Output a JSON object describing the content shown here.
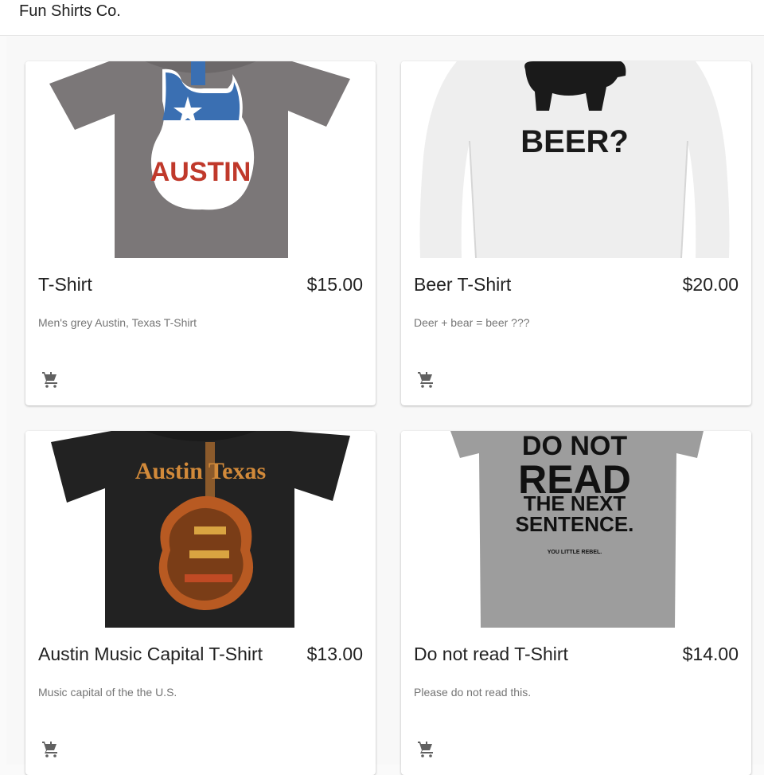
{
  "app": {
    "title": "Fun Shirts Co."
  },
  "products": [
    {
      "name": "T-Shirt",
      "price": "$15.00",
      "description": "Men's grey Austin, Texas T-Shirt",
      "image_text": "AUSTIN",
      "icon": "add-shopping-cart-icon"
    },
    {
      "name": "Beer T-Shirt",
      "price": "$20.00",
      "description": "Deer + bear = beer ???",
      "image_text": "BEER?",
      "icon": "add-shopping-cart-icon"
    },
    {
      "name": "Austin Music Capital T-Shirt",
      "price": "$13.00",
      "description": "Music capital of the the U.S.",
      "image_text": "Austin Texas",
      "icon": "add-shopping-cart-icon"
    },
    {
      "name": "Do not read T-Shirt",
      "price": "$14.00",
      "description": "Please do not read this.",
      "image_text": {
        "line1": "DO NOT",
        "line2": "READ",
        "line3": "THE NEXT",
        "line4": "SENTENCE.",
        "line5": "YOU LITTLE REBEL."
      },
      "icon": "add-shopping-cart-icon"
    }
  ],
  "colors": {
    "background": "#f8f8f8",
    "card": "#ffffff",
    "text_primary": "#222222",
    "text_secondary": "#757575",
    "icon": "#616161"
  }
}
